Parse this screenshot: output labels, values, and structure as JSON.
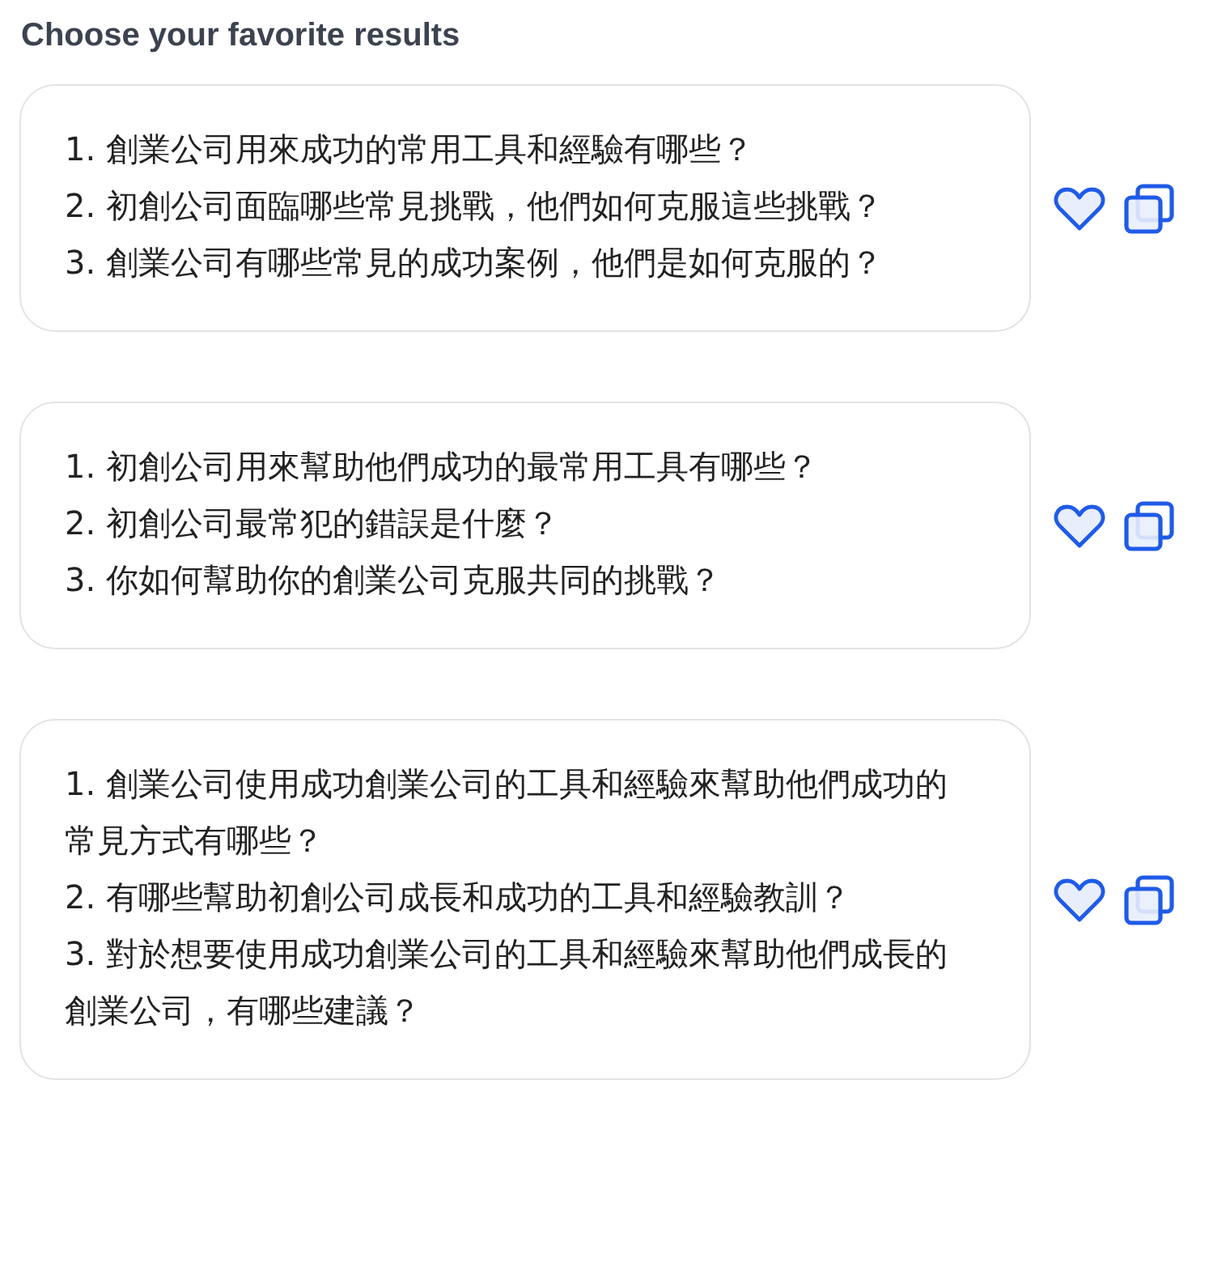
{
  "title": "Choose your favorite results",
  "results": [
    {
      "questions": [
        "1. 創業公司用來成功的常用工具和經驗有哪些？",
        "2. 初創公司面臨哪些常見挑戰，他們如何克服這些挑戰？",
        "3. 創業公司有哪些常見的成功案例，他們是如何克服的？"
      ]
    },
    {
      "questions": [
        "1. 初創公司用來幫助他們成功的最常用工具有哪些？",
        "2. 初創公司最常犯的錯誤是什麼？",
        "3. 你如何幫助你的創業公司克服共同的挑戰？"
      ]
    },
    {
      "questions": [
        "1. 創業公司使用成功創業公司的工具和經驗來幫助他們成功的常見方式有哪些？",
        "2. 有哪些幫助初創公司成長和成功的工具和經驗教訓？",
        "3. 對於想要使用成功創業公司的工具和經驗來幫助他們成長的創業公司，有哪些建議？"
      ]
    }
  ]
}
